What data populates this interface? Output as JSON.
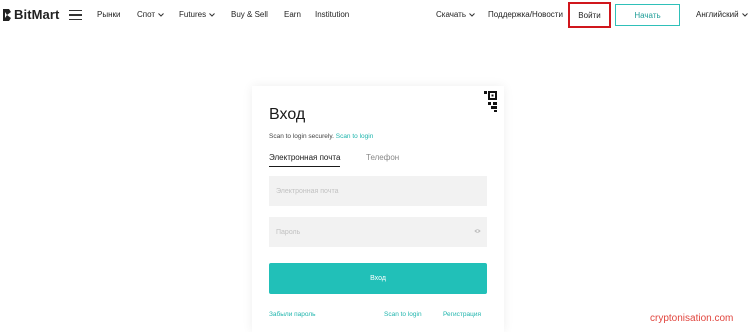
{
  "header": {
    "logo_text": "BitMart",
    "nav": {
      "markets": "Рынки",
      "spot": "Спот",
      "futures": "Futures",
      "buy_sell": "Buy & Sell",
      "earn": "Earn",
      "institution": "Institution"
    },
    "download": "Скачать",
    "support": "Поддержка/Новости",
    "login": "Войти",
    "start": "Начать",
    "language": "Английский"
  },
  "login_card": {
    "title": "Вход",
    "scan_text": "Scan to login securely.",
    "scan_link": "Scan to login",
    "tabs": {
      "email": "Электронная почта",
      "phone": "Телефон"
    },
    "email_placeholder": "Электронная почта",
    "password_placeholder": "Пароль",
    "submit": "Вход",
    "forgot_password": "Забыли пароль",
    "scan_to_login": "Scan to login",
    "register": "Регистрация"
  },
  "watermark": "cryptonisation.com",
  "colors": {
    "accent": "#21c0b8",
    "highlight": "#d0161c"
  },
  "icons": [
    "bitmart-logo-icon",
    "menu-icon",
    "chevron-down-icon",
    "qr-code-icon",
    "eye-icon"
  ]
}
